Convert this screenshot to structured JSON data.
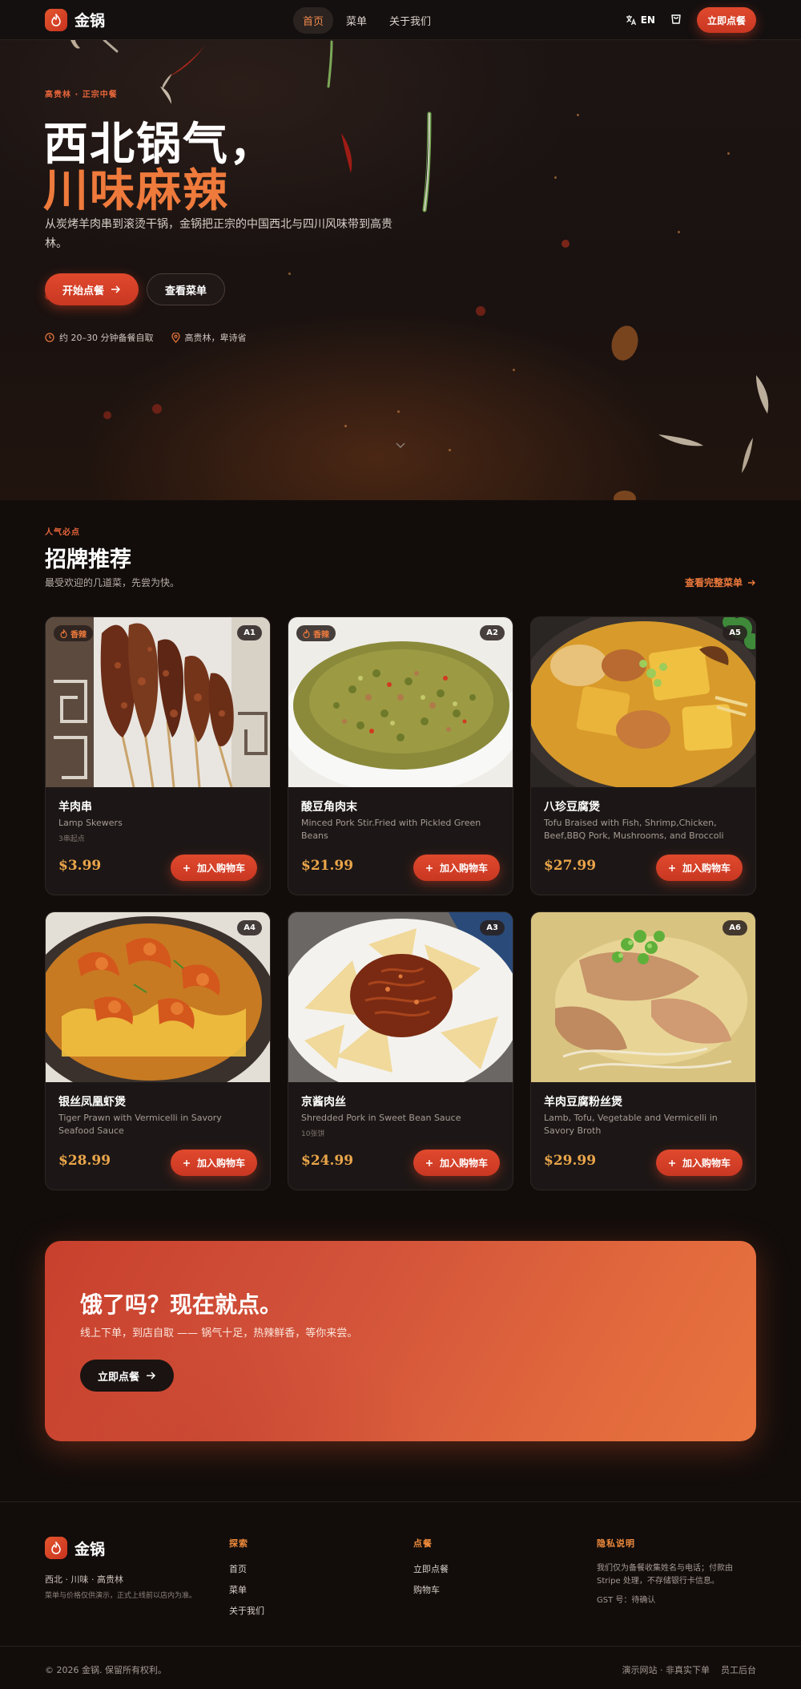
{
  "brand": {
    "name": "金锅"
  },
  "nav": {
    "links": [
      "首页",
      "菜单",
      "关于我们"
    ],
    "lang": "EN",
    "order": "立即点餐"
  },
  "hero": {
    "eyebrow": "高贵林 · 正宗中餐",
    "title_line1": "西北锅气，",
    "title_line2": "川味麻辣",
    "desc": "从炭烤羊肉串到滚烫干锅，金锅把正宗的中国西北与四川风味带到高贵林。",
    "btn_start": "开始点餐",
    "btn_menu": "查看菜单",
    "meta_time": "约 20–30 分钟备餐自取",
    "meta_location": "高贵林，卑诗省"
  },
  "signature": {
    "eyebrow": "人气必点",
    "title": "招牌推荐",
    "subtitle": "最受欢迎的几道菜，先尝为快。",
    "full_menu_link": "查看完整菜单"
  },
  "dishes": [
    {
      "code": "A1",
      "spicy": "香辣",
      "name": "羊肉串",
      "en": "Lamp Skewers",
      "note": "3串起点",
      "price": "$3.99",
      "add": "加入购物车"
    },
    {
      "code": "A2",
      "spicy": "香辣",
      "name": "酸豆角肉末",
      "en": "Minced Pork Stir.Fried with Pickled Green Beans",
      "note": "",
      "price": "$21.99",
      "add": "加入购物车"
    },
    {
      "code": "A5",
      "spicy": "",
      "name": "八珍豆腐煲",
      "en": "Tofu Braised with Fish, Shrimp,Chicken, Beef,BBQ Pork, Mushrooms, and Broccoli",
      "note": "",
      "price": "$27.99",
      "add": "加入购物车"
    },
    {
      "code": "A4",
      "spicy": "",
      "name": "银丝凤凰虾煲",
      "en": "Tiger Prawn with Vermicelli in Savory Seafood Sauce",
      "note": "",
      "price": "$28.99",
      "add": "加入购物车"
    },
    {
      "code": "A3",
      "spicy": "",
      "name": "京酱肉丝",
      "en": "Shredded Pork in Sweet Bean Sauce",
      "note": "10张饼",
      "price": "$24.99",
      "add": "加入购物车"
    },
    {
      "code": "A6",
      "spicy": "",
      "name": "羊肉豆腐粉丝煲",
      "en": "Lamb, Tofu, Vegetable and Vermicelli in Savory Broth",
      "note": "",
      "price": "$29.99",
      "add": "加入购物车"
    }
  ],
  "cta": {
    "title": "饿了吗？现在就点。",
    "subtitle": "线上下单，到店自取 —— 锅气十足，热辣鲜香，等你来尝。",
    "button": "立即点餐"
  },
  "footer": {
    "brand_sub": "西北 · 川味 · 高贵林",
    "brand_note": "菜单与价格仅供演示，正式上线前以店内为准。",
    "explore_title": "探索",
    "explore_links": [
      "首页",
      "菜单",
      "关于我们"
    ],
    "order_title": "点餐",
    "order_links": [
      "立即点餐",
      "购物车"
    ],
    "privacy_title": "隐私说明",
    "privacy_text": "我们仅为备餐收集姓名与电话；付款由 Stripe 处理，不存储银行卡信息。",
    "gst": "GST 号：待确认",
    "copyright": "© 2026 金锅. 保留所有权利。",
    "demo_link": "演示网站 · 非真实下单",
    "staff_link": "员工后台"
  },
  "colors": {
    "accent": "#e0492d",
    "orange": "#ee7a3c",
    "price": "#eaa54a",
    "bg": "#120d0b"
  }
}
